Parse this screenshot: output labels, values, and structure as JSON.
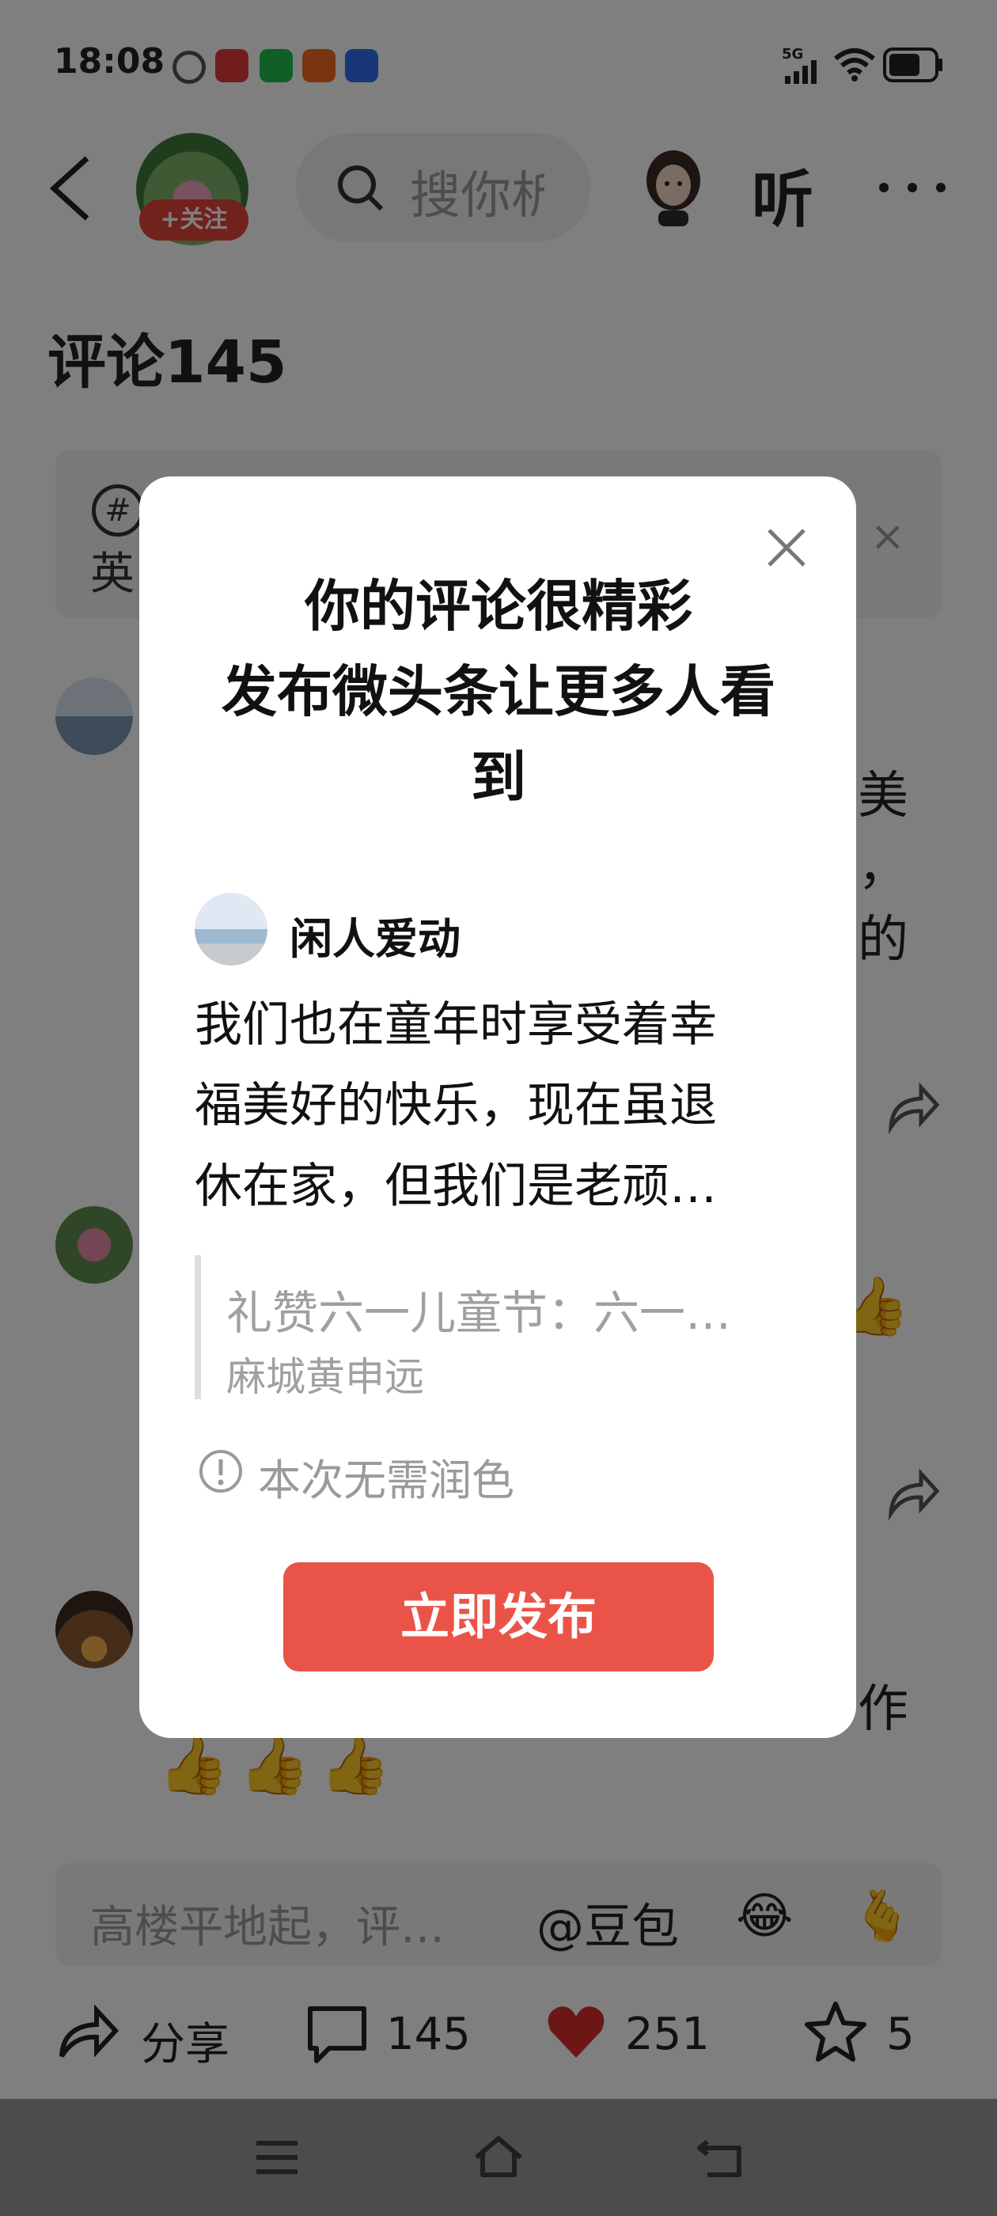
{
  "status_bar": {
    "time": "18:08",
    "network": "5G",
    "app_icons": [
      "timer-icon",
      "toutiao-icon",
      "wechat-icon",
      "kuaishou-icon",
      "baidu-icon"
    ]
  },
  "header": {
    "follow_label": "+关注",
    "search_placeholder": "搜你析",
    "listen_label": "听"
  },
  "comments": {
    "title": "评论145",
    "topic_card": {
      "glyph": "#",
      "text": "英",
      "close": "×"
    },
    "bg_fragments": [
      "美",
      "，",
      "的",
      "作"
    ]
  },
  "input": {
    "placeholder": "高楼平地起，评…",
    "mention": "@豆包",
    "emojis": [
      "😂",
      "🫰"
    ]
  },
  "toolbar": {
    "share_label": "分享",
    "comment_count": "145",
    "like_count": "251",
    "favorite_count": "5"
  },
  "modal": {
    "title_line1": "你的评论很精彩",
    "title_line2": "发布微头条让更多人看",
    "title_line3": "到",
    "author_name": "闲人爱动",
    "comment_line1": "我们也在童年时享受着幸",
    "comment_line2": "福美好的快乐，现在虽退",
    "comment_line3": "休在家，但我们是老顽…",
    "quote_title": "礼赞六一儿童节：六一…",
    "quote_author": "麻城黄申远",
    "info_text": "本次无需润色",
    "publish_label": "立即发布"
  },
  "colors": {
    "accent_red": "#ea5448",
    "follow_red": "#e3443b",
    "heart_red": "#d92c2c",
    "nav_bar": "#4c4c4e"
  }
}
